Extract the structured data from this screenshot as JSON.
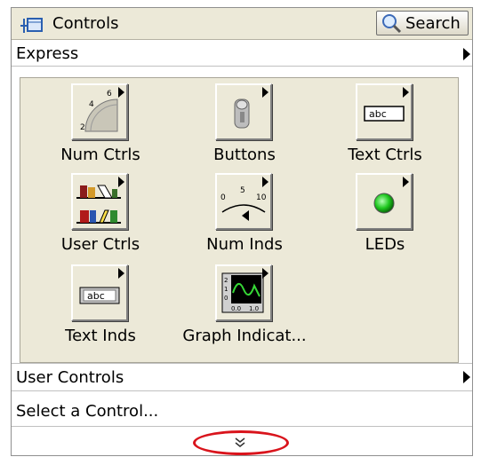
{
  "palette": {
    "title": "Controls",
    "search_label": "Search",
    "icons": {
      "pin": "pin-icon",
      "search": "magnifier-icon"
    }
  },
  "rows": {
    "express": "Express",
    "user_controls": "User Controls",
    "select_control": "Select a Control..."
  },
  "express_items": [
    {
      "label": "Num Ctrls",
      "icon": "num-ctrls-icon"
    },
    {
      "label": "Buttons",
      "icon": "buttons-icon"
    },
    {
      "label": "Text Ctrls",
      "icon": "text-ctrls-icon"
    },
    {
      "label": "User Ctrls",
      "icon": "user-ctrls-icon"
    },
    {
      "label": "Num Inds",
      "icon": "num-inds-icon"
    },
    {
      "label": "LEDs",
      "icon": "leds-icon"
    },
    {
      "label": "Text Inds",
      "icon": "text-inds-icon"
    },
    {
      "label": "Graph Indicat...",
      "icon": "graph-indicators-icon"
    }
  ],
  "colors": {
    "highlight_oval": "#d9141c",
    "panel_bg": "#ece9d8",
    "led_green": "#1fc81f"
  },
  "icon_text": {
    "text_ctrl_sample": "abc",
    "text_ind_sample": "abc",
    "num_ctrl_ticks": [
      "2",
      "4",
      "6"
    ],
    "num_ind_ticks": [
      "0",
      "5",
      "10"
    ],
    "graph_axis": [
      "2",
      "1",
      "0",
      "0.0",
      "1.0"
    ]
  }
}
